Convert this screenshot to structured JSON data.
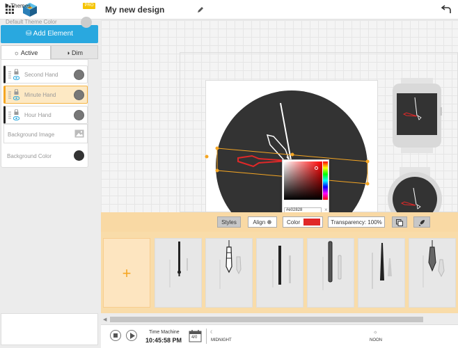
{
  "header": {
    "title": "My new design"
  },
  "sidebar": {
    "add_element": "Add Element",
    "tabs": {
      "active": "Active",
      "dim": "Dim"
    },
    "layers": [
      {
        "label": "Second Hand"
      },
      {
        "label": "Minute Hand"
      },
      {
        "label": "Hour Hand"
      }
    ],
    "background_image": "Background Image",
    "background_color": "Background Color",
    "themes": {
      "title": "Themes",
      "pro": "PRO",
      "default_theme": "Default Theme Color"
    }
  },
  "color_picker": {
    "hex": "#e02828"
  },
  "toolbar": {
    "styles": "Styles",
    "align": "Align",
    "color": "Color",
    "transparency": "Transparency: 100%",
    "color_value": "#e02828"
  },
  "gallery": {
    "add_symbol": "+"
  },
  "time_machine": {
    "label": "Time Machine",
    "time": "10:45:58 PM",
    "calendar_day": "4/0",
    "midnight": "MIDNIGHT",
    "noon": "NOON"
  },
  "colors": {
    "accent": "#29a8df",
    "selection": "#f5a623",
    "watch_face": "#333333",
    "hand_red": "#e02828"
  }
}
